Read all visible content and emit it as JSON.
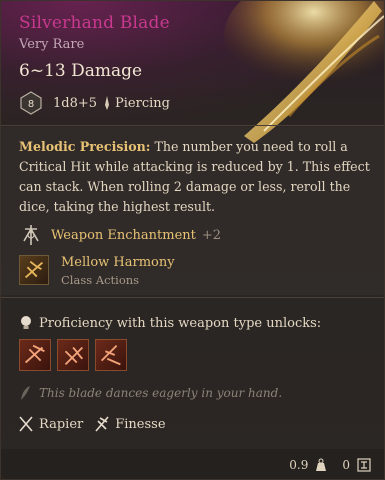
{
  "item": {
    "name": "Silverhand Blade",
    "rarity": "Very Rare",
    "damage": "6~13 Damage",
    "dice_icon_value": "8",
    "dice": "1d8+5",
    "damage_type": "Piercing"
  },
  "description": {
    "ability_name": "Melodic Precision:",
    "text": " The number you need to roll a Critical Hit while attacking is reduced by 1. This effect can stack. When rolling 2 damage or less, reroll the dice, taking the highest result."
  },
  "enchantment": {
    "label": "Weapon Enchantment",
    "bonus": "+2"
  },
  "action": {
    "name": "Mellow Harmony",
    "category": "Class Actions"
  },
  "proficiency": {
    "text": "Proficiency with this weapon type unlocks:",
    "skills": [
      "skill-1",
      "skill-2",
      "skill-3"
    ]
  },
  "flavor": "This blade dances eagerly in your hand.",
  "properties": [
    "Rapier",
    "Finesse"
  ],
  "footer": {
    "weight": "0.9",
    "value": "0"
  },
  "colors": {
    "title": "#c8398f",
    "accent": "#e7c274"
  }
}
